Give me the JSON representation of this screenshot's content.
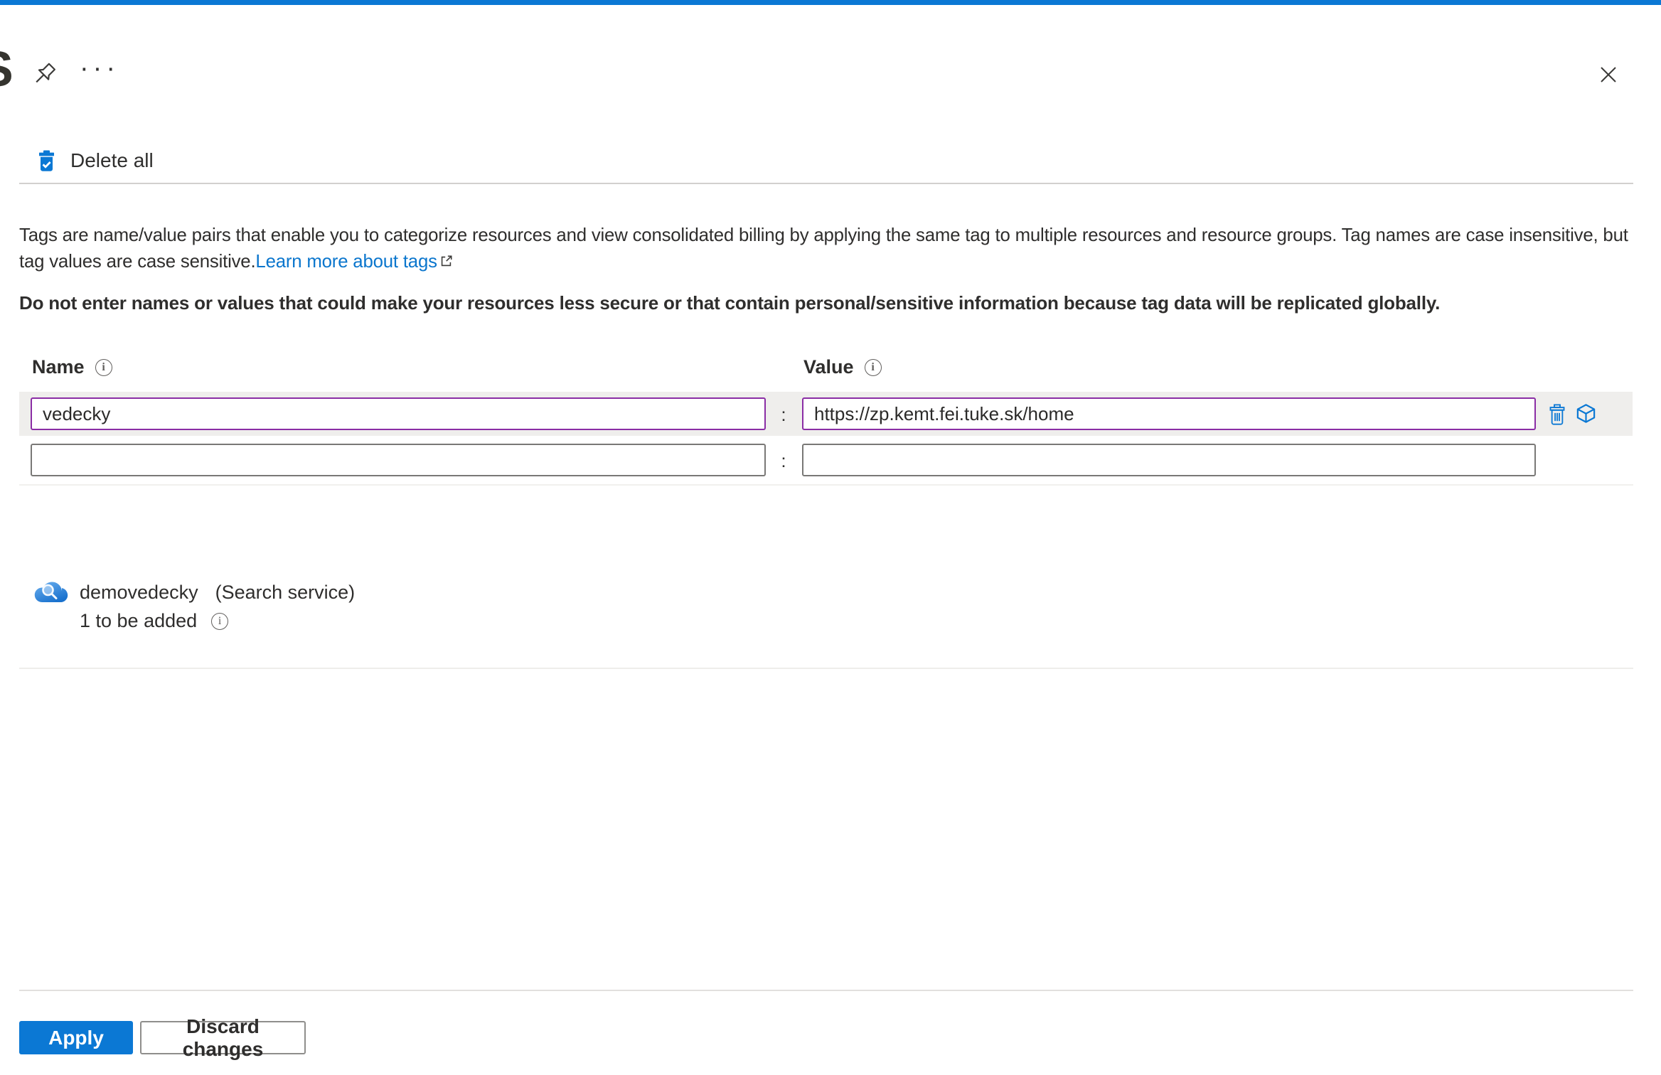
{
  "header": {
    "title_partial": "S",
    "more_icon": "···"
  },
  "toolbar": {
    "delete_all": "Delete all"
  },
  "intro": {
    "body": "Tags are name/value pairs that enable you to categorize resources and view consolidated billing by applying the same tag to multiple resources and resource groups. Tag names are case insensitive, but tag values are case sensitive.",
    "link": "Learn more about tags",
    "warning": "Do not enter names or values that could make your resources less secure or that contain personal/sensitive information because tag data will be replicated globally."
  },
  "tags_table": {
    "name_header": "Name",
    "value_header": "Value",
    "separator": ":",
    "rows": [
      {
        "name": "vedecky",
        "value": "https://zp.kemt.fei.tuke.sk/home"
      },
      {
        "name": "",
        "value": ""
      }
    ]
  },
  "resource": {
    "name": "demovedecky",
    "type": "(Search service)",
    "pending": "1 to be added"
  },
  "footer": {
    "apply": "Apply",
    "discard": "Discard changes"
  },
  "icons": {
    "info": "i"
  },
  "colors": {
    "accent": "#0078d4",
    "focus_border": "#8a2da5",
    "row_highlight": "#efeeec"
  }
}
